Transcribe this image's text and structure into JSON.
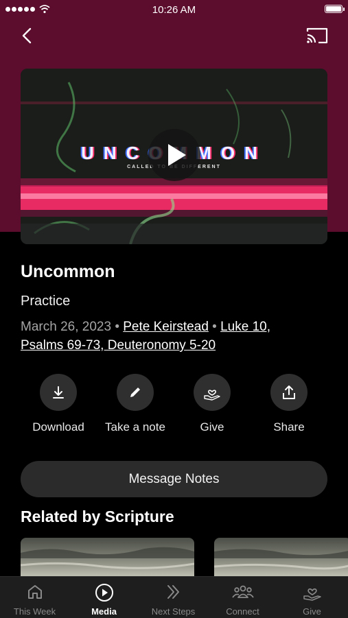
{
  "status_bar": {
    "time": "10:26 AM"
  },
  "nav": {
    "back_icon": "chevron-left-icon",
    "cast_icon": "cast-icon"
  },
  "video": {
    "title_art": "UNCOMMON",
    "subtitle_art": "CALLED TO BE DIFFERENT",
    "play_icon": "play-icon"
  },
  "sermon": {
    "title": "Uncommon",
    "series": "Practice",
    "date": "March 26, 2023",
    "separator": "•",
    "speaker": "Pete Keirstead",
    "scripture_line1": "Luke 10,",
    "scripture_line2": "Psalms 69-73, Deuteronomy 5-20"
  },
  "actions": [
    {
      "label": "Download",
      "icon": "download-icon"
    },
    {
      "label": "Take a note",
      "icon": "pencil-icon"
    },
    {
      "label": "Give",
      "icon": "give-heart-icon"
    },
    {
      "label": "Share",
      "icon": "share-icon"
    }
  ],
  "message_notes_label": "Message Notes",
  "related": {
    "title": "Related by Scripture"
  },
  "tabs": [
    {
      "label": "This Week",
      "icon": "home-icon",
      "active": false
    },
    {
      "label": "Media",
      "icon": "play-circle-icon",
      "active": true
    },
    {
      "label": "Next Steps",
      "icon": "chevrons-right-icon",
      "active": false
    },
    {
      "label": "Connect",
      "icon": "people-icon",
      "active": false
    },
    {
      "label": "Give",
      "icon": "give-heart-icon",
      "active": false
    }
  ],
  "colors": {
    "header_bg": "#5c0c2c",
    "accent_pink": "#ff2d6a",
    "surface": "#2b2b2b",
    "tabbar_bg": "#1e1e1e"
  }
}
